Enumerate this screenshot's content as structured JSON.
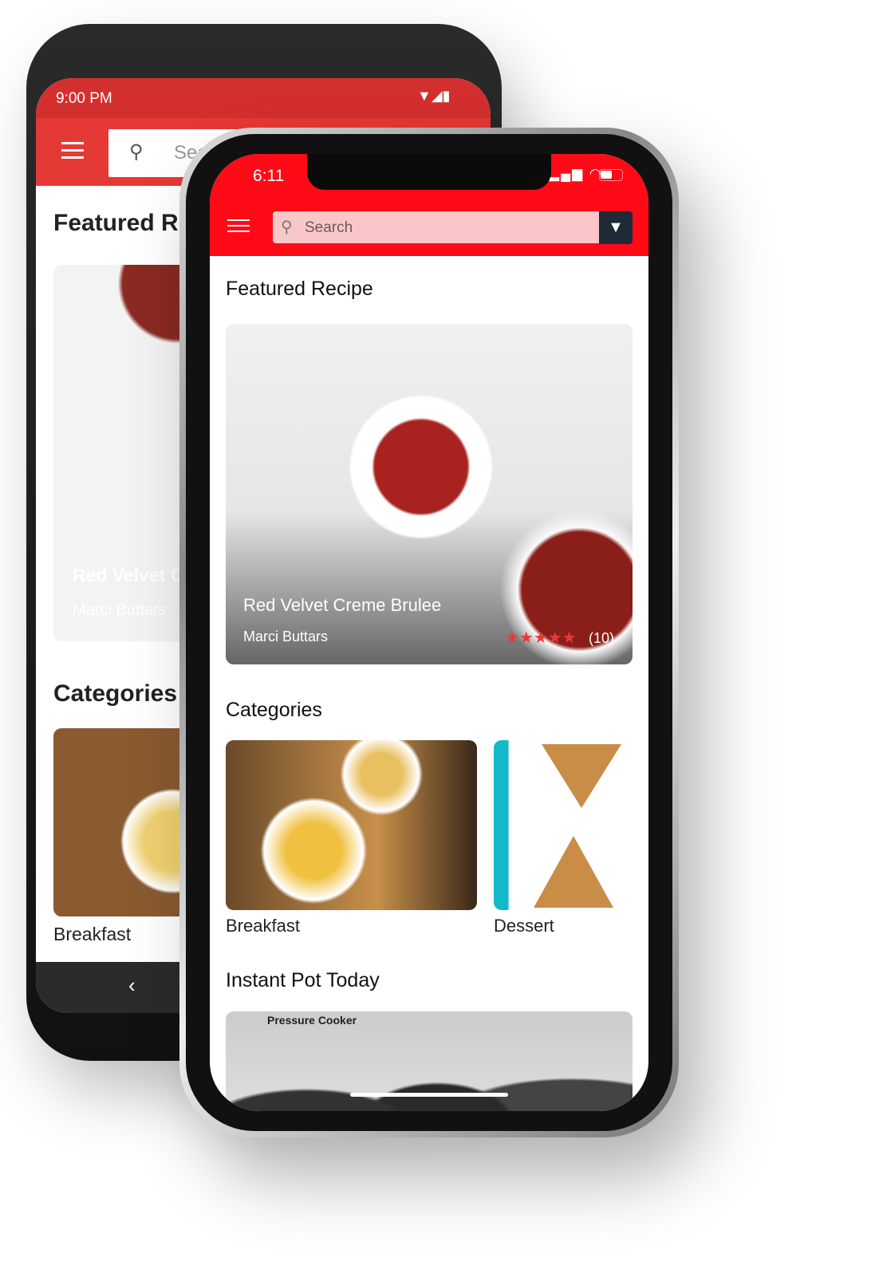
{
  "android": {
    "status_time": "9:00 PM",
    "search_placeholder": "Search",
    "featured_heading": "Featured Recipe",
    "featured_title": "Red Velvet Creme Brulee",
    "featured_author": "Marci Buttars",
    "categories_heading": "Categories",
    "categories": [
      {
        "label": "Breakfast"
      }
    ],
    "back_glyph": "‹"
  },
  "iphone": {
    "status_time": "6:11",
    "search_placeholder": "Search",
    "featured_heading": "Featured Recipe",
    "featured": {
      "title": "Red Velvet Creme Brulee",
      "author": "Marci Buttars",
      "rating": 5,
      "stars": "★★★★★",
      "review_count": "(10)"
    },
    "categories_heading": "Categories",
    "categories": [
      {
        "label": "Breakfast"
      },
      {
        "label": "Dessert"
      }
    ],
    "instant_pot_heading": "Instant Pot Today",
    "instant_pot_image_text": "Pressure Cooker"
  },
  "colors": {
    "accent": "#ff0a16",
    "android_accent": "#e53935",
    "filter_button": "#1f2a38",
    "star": "#e53935"
  }
}
